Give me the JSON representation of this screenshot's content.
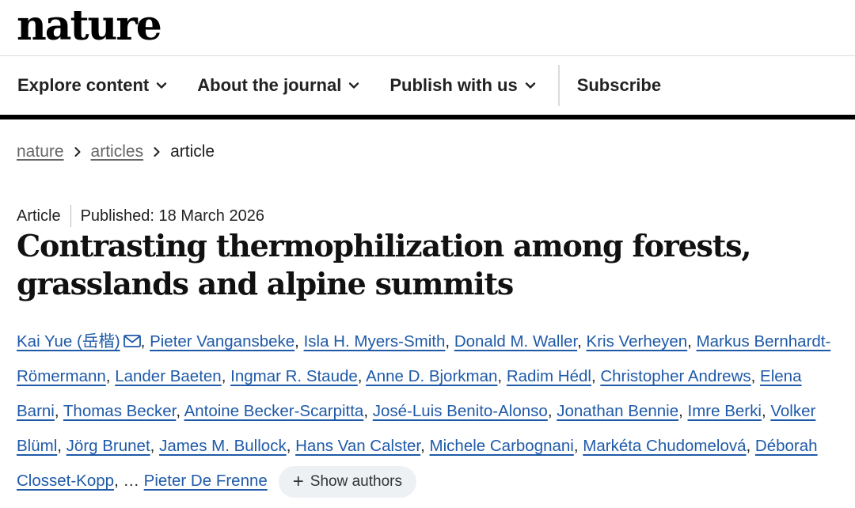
{
  "brand": {
    "logo": "nature"
  },
  "nav": {
    "explore": "Explore content",
    "about": "About the journal",
    "publish": "Publish with us",
    "subscribe": "Subscribe"
  },
  "breadcrumb": {
    "root": "nature",
    "section": "articles",
    "current": "article"
  },
  "article": {
    "type": "Article",
    "published": "Published: 18 March 2026",
    "title": "Contrasting thermophilization among forests, grasslands and alpine summits"
  },
  "authors": {
    "list": [
      "Kai Yue (岳楷)",
      "Pieter Vangansbeke",
      "Isla H. Myers-Smith",
      "Donald M. Waller",
      "Kris Verheyen",
      "Markus Bernhardt-Römermann",
      "Lander Baeten",
      "Ingmar R. Staude",
      "Anne D. Bjorkman",
      "Radim Hédl",
      "Christopher Andrews",
      "Elena Barni",
      "Thomas Becker",
      "Antoine Becker-Scarpitta",
      "José-Luis Benito-Alonso",
      "Jonathan Bennie",
      "Imre Berki",
      "Volker Blüml",
      "Jörg Brunet",
      "James M. Bullock",
      "Hans Van Calster",
      "Michele Carbognani",
      "Markéta Chudomelová",
      "Déborah Closset-Kopp"
    ],
    "ellipsis": "…",
    "last": "Pieter De Frenne",
    "show_authors": "Show authors"
  },
  "colors": {
    "link": "#1f5aa8",
    "rule": "#000000",
    "pill_bg": "#eef1f4"
  }
}
